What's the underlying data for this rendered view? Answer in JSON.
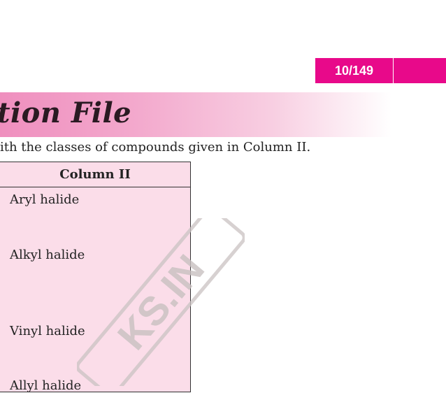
{
  "page_indicator": "10/149",
  "banner": {
    "title": "tion File"
  },
  "instruction": "ith the classes of compounds given in Column II.",
  "table": {
    "header": "Column II",
    "rows": [
      "Aryl halide",
      "Alkyl halide",
      "Vinyl halide",
      "Allyl halide"
    ]
  },
  "watermark": {
    "text": "KS.IN"
  },
  "colors": {
    "accent": "#e8098a",
    "table_bg": "#fbdde9"
  }
}
